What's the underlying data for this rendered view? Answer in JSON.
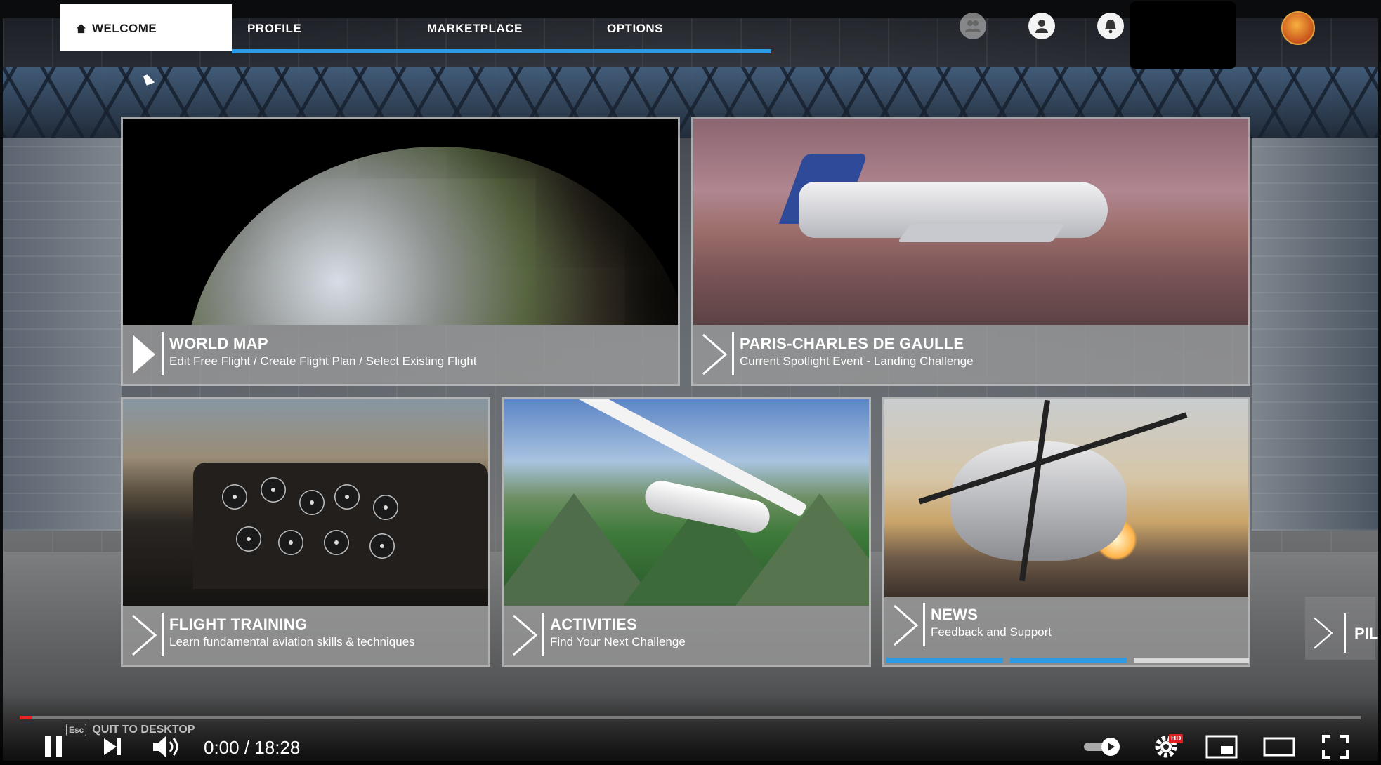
{
  "nav": {
    "tabs": [
      {
        "label": "WELCOME",
        "active": true
      },
      {
        "label": "PROFILE",
        "active": false
      },
      {
        "label": "MARKETPLACE",
        "active": false
      },
      {
        "label": "OPTIONS",
        "active": false
      }
    ],
    "icons": [
      "friends-icon",
      "profile-icon",
      "notifications-icon"
    ]
  },
  "tiles": {
    "world_map": {
      "title": "WORLD MAP",
      "subtitle": "Edit Free Flight / Create Flight Plan / Select Existing Flight"
    },
    "spotlight": {
      "title": "PARIS-CHARLES DE GAULLE",
      "subtitle": "Current Spotlight Event - Landing Challenge"
    },
    "training": {
      "title": "FLIGHT TRAINING",
      "subtitle": "Learn fundamental aviation skills & techniques"
    },
    "activities": {
      "title": "ACTIVITIES",
      "subtitle": "Find Your Next Challenge"
    },
    "news": {
      "title": "NEWS",
      "subtitle": "Feedback and Support"
    },
    "peek": {
      "title": "PIL"
    }
  },
  "overlay": {
    "esc_key": "Esc",
    "quit_label": "QUIT TO DESKTOP"
  },
  "player": {
    "current_time": "0:00",
    "separator": " / ",
    "duration": "18:28",
    "quality_badge": "HD"
  },
  "colors": {
    "accent_blue": "#2b9be6",
    "progress_red": "#e22222"
  }
}
